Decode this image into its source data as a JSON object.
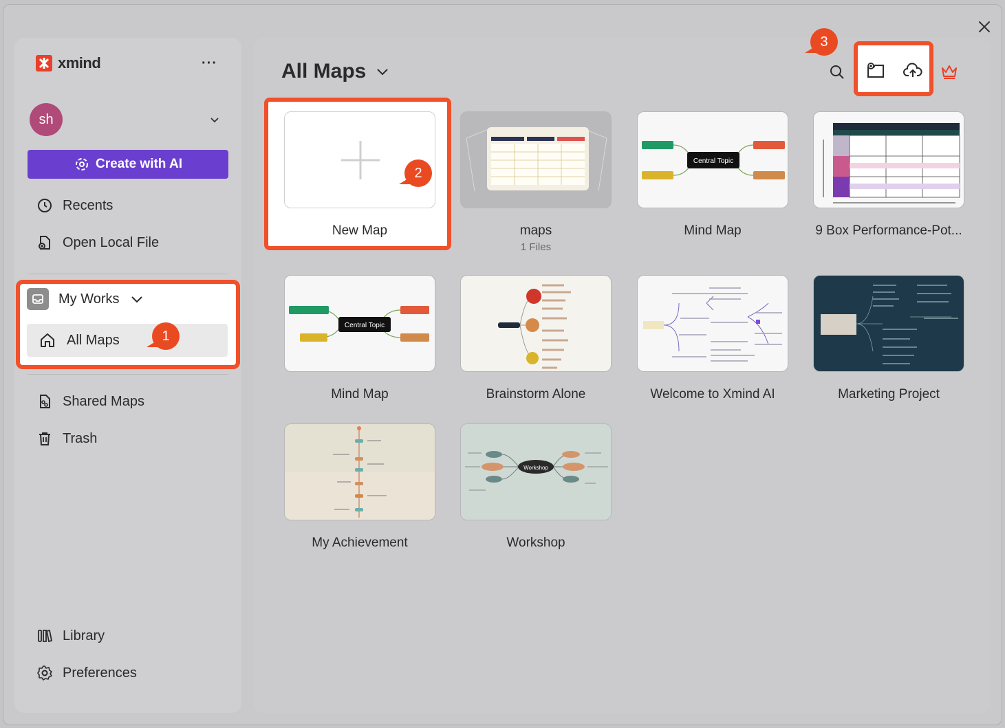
{
  "app": {
    "name": "xmind"
  },
  "sidebar": {
    "avatar_initials": "sh",
    "create_ai_label": "Create with AI",
    "recents_label": "Recents",
    "open_local_label": "Open Local File",
    "my_works_label": "My Works",
    "all_maps_label": "All Maps",
    "shared_maps_label": "Shared Maps",
    "trash_label": "Trash",
    "library_label": "Library",
    "preferences_label": "Preferences"
  },
  "main": {
    "title": "All Maps",
    "new_map_label": "New Map",
    "cards": [
      {
        "label": "maps",
        "sub": "1 Files"
      },
      {
        "label": "Mind Map"
      },
      {
        "label": "9 Box Performance-Pot..."
      },
      {
        "label": "Mind Map"
      },
      {
        "label": "Brainstorm Alone"
      },
      {
        "label": "Welcome to Xmind AI"
      },
      {
        "label": "Marketing Project"
      },
      {
        "label": "My Achievement"
      },
      {
        "label": "Workshop"
      }
    ]
  },
  "thumbnails": {
    "central_topic": "Central Topic",
    "workshop_node": "Workshop"
  },
  "markers": {
    "m1": "1",
    "m2": "2",
    "m3": "3"
  },
  "colors": {
    "accent": "#6a3fcf",
    "highlight": "#f0502a",
    "brand": "#e8402b"
  }
}
